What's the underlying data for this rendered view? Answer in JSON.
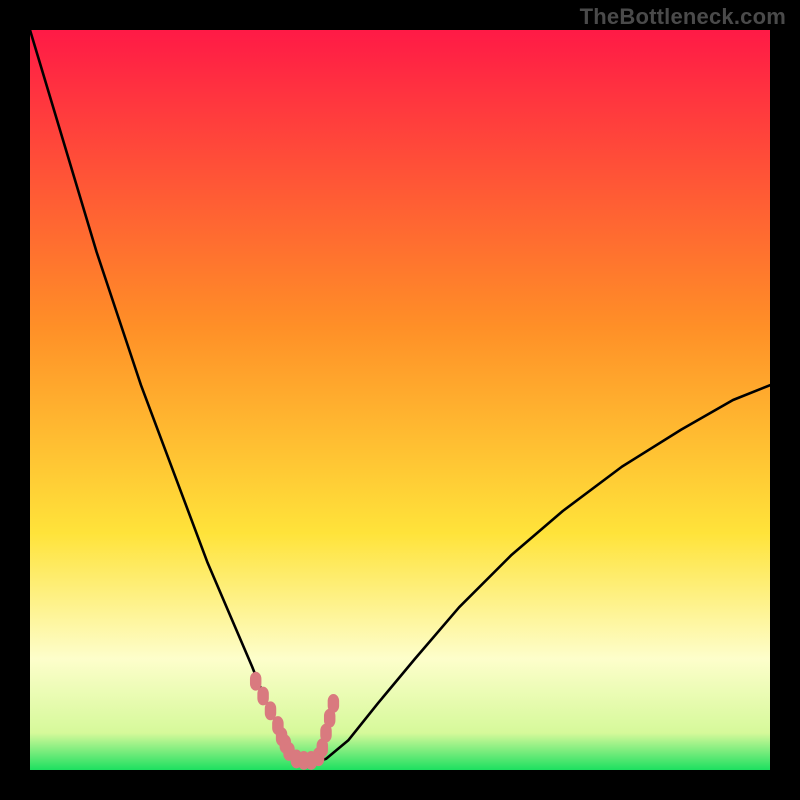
{
  "watermark": "TheBottleneck.com",
  "colors": {
    "frame_bg": "#000000",
    "gradient_top": "#ff1a46",
    "gradient_mid1": "#ff8f27",
    "gradient_mid2": "#ffe33a",
    "gradient_low": "#fdfecb",
    "gradient_bottom": "#1de060",
    "curve": "#000000",
    "marker_fill": "#d97a7f",
    "marker_stroke": "#d97a7f"
  },
  "chart_data": {
    "type": "line",
    "title": "",
    "xlabel": "",
    "ylabel": "",
    "xlim": [
      0,
      100
    ],
    "ylim": [
      0,
      100
    ],
    "grid": false,
    "legend": false,
    "annotations": [
      "TheBottleneck.com"
    ],
    "series": [
      {
        "name": "bottleneck-curve",
        "x": [
          0,
          3,
          6,
          9,
          12,
          15,
          18,
          21,
          24,
          27,
          30,
          32,
          34,
          35,
          36,
          37,
          38,
          40,
          43,
          47,
          52,
          58,
          65,
          72,
          80,
          88,
          95,
          100
        ],
        "y": [
          100,
          90,
          80,
          70,
          61,
          52,
          44,
          36,
          28,
          21,
          14,
          9,
          5,
          3,
          1.5,
          1,
          1,
          1.5,
          4,
          9,
          15,
          22,
          29,
          35,
          41,
          46,
          50,
          52
        ]
      }
    ],
    "markers": {
      "name": "highlight-region",
      "x": [
        30.5,
        31.5,
        32.5,
        33.5,
        34,
        34.5,
        35,
        36,
        37,
        38,
        39,
        39.5,
        40,
        40.5,
        41
      ],
      "y": [
        12,
        10,
        8,
        6,
        4.5,
        3.5,
        2.5,
        1.5,
        1.3,
        1.3,
        1.8,
        3,
        5,
        7,
        9
      ]
    },
    "gradient_stops": [
      {
        "offset": 0.0,
        "color": "#ff1a46"
      },
      {
        "offset": 0.4,
        "color": "#ff8f27"
      },
      {
        "offset": 0.68,
        "color": "#ffe33a"
      },
      {
        "offset": 0.85,
        "color": "#fdfecb"
      },
      {
        "offset": 0.95,
        "color": "#d6f99a"
      },
      {
        "offset": 1.0,
        "color": "#1de060"
      }
    ]
  }
}
